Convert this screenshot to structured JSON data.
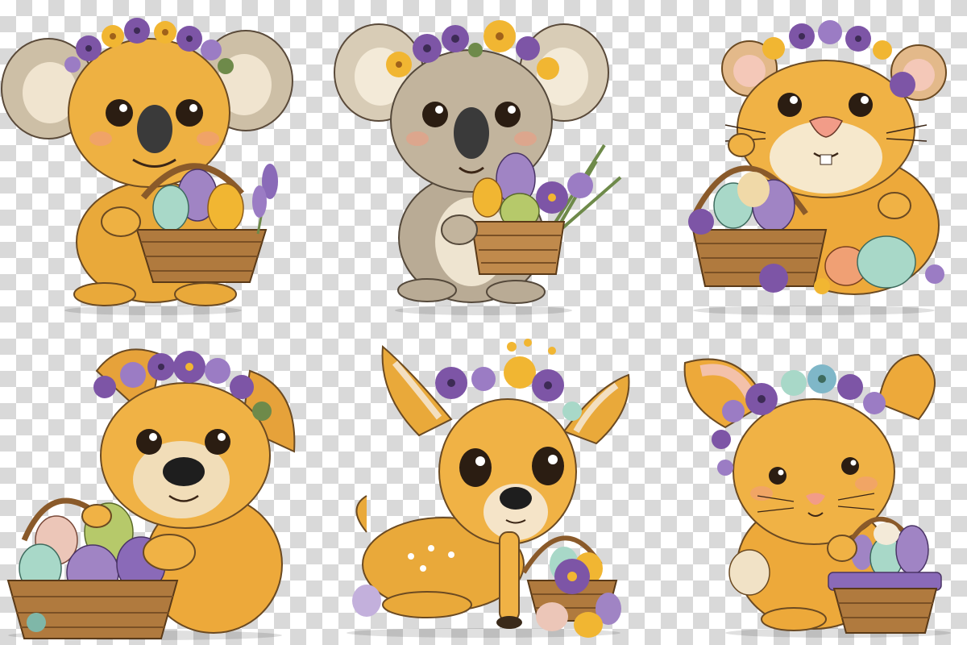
{
  "figures": [
    {
      "animal": "koala",
      "accessories": [
        "flower-crown",
        "egg-basket",
        "lavender"
      ]
    },
    {
      "animal": "koala",
      "accessories": [
        "flower-crown",
        "egg-basket",
        "purple-flowers",
        "greenery"
      ]
    },
    {
      "animal": "hamster",
      "accessories": [
        "flower-crown",
        "egg-basket",
        "eggs",
        "purple-flowers"
      ]
    },
    {
      "animal": "puppy",
      "accessories": [
        "flower-crown",
        "egg-basket"
      ]
    },
    {
      "animal": "fawn",
      "accessories": [
        "flower-crown",
        "egg-basket",
        "eggs",
        "purple-flowers"
      ]
    },
    {
      "animal": "bunny",
      "accessories": [
        "flower-crown",
        "egg-basket"
      ]
    }
  ],
  "palette": {
    "fur_orange": "#e9a93a",
    "fur_grey": "#b9ab95",
    "cream": "#f2e6cc",
    "flower_purple": "#7d55a6",
    "flower_yellow": "#f1b632",
    "egg_mint": "#a8d8c8",
    "egg_lilac": "#a084c4",
    "egg_green": "#b6c96a",
    "basket": "#b07a3e",
    "leaf": "#6e8a4a",
    "checker_light": "#ffffff",
    "checker_dark": "#d9d9d9"
  }
}
